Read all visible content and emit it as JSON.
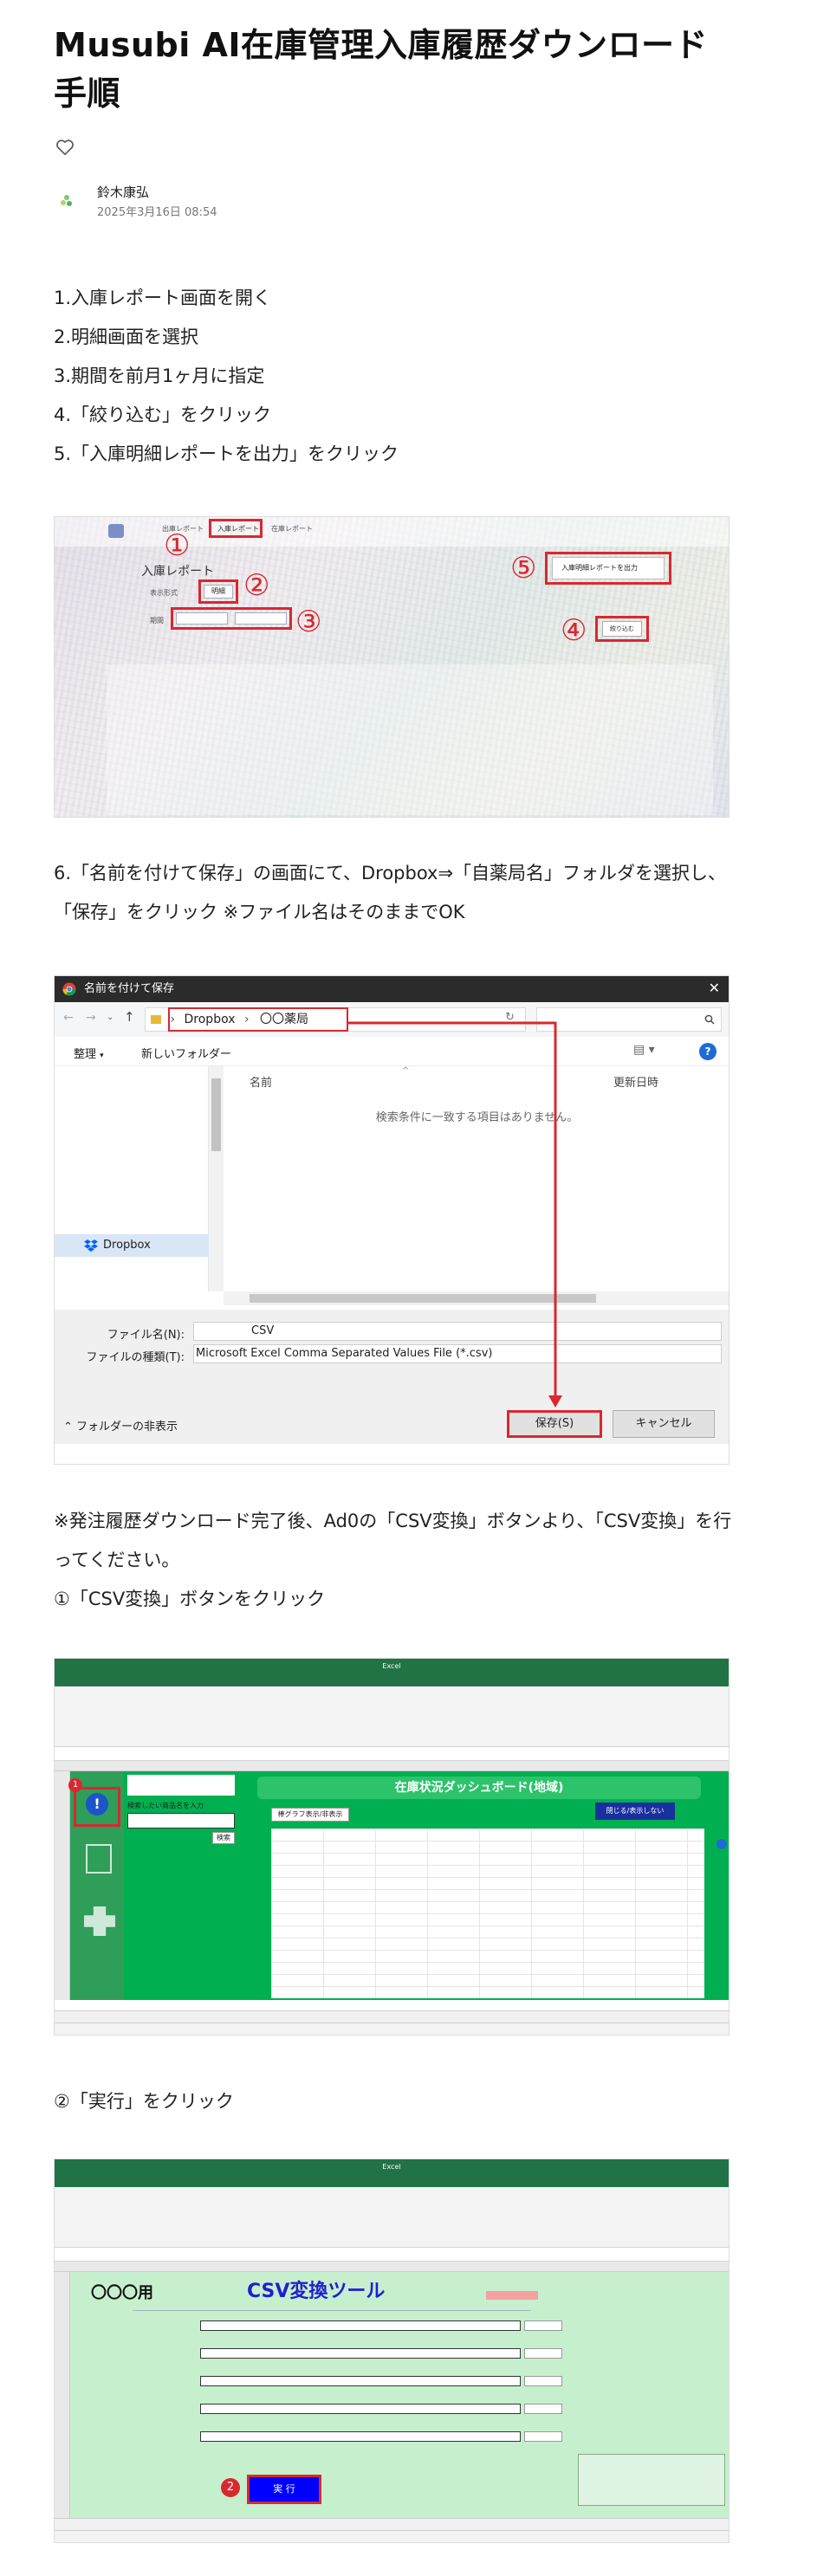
{
  "article": {
    "title": "Musubi AI在庫管理入庫履歴ダウンロード手順",
    "author": "鈴木康弘",
    "date": "2025年3月16日 08:54"
  },
  "steps": [
    "1.入庫レポート画面を開く",
    "2.明細画面を選択",
    "3.期間を前月1ヶ月に指定",
    "4.「絞り込む」をクリック",
    "5.「入庫明細レポートを出力」をクリック"
  ],
  "step6": "6.「名前を付けて保存」の画面にて、Dropbox⇒「自薬局名」フォルダを選択し、「保存」をクリック ※ファイル名はそのままでOK",
  "note": "※発注履歴ダウンロード完了後、Ad0の「CSV変換」ボタンより、「CSV変換」を行ってください。",
  "substep1": "①「CSV変換」ボタンをクリック",
  "substep2": "②「実行」をクリック",
  "shot1": {
    "tabs": [
      "出庫レポート",
      "入庫レポート",
      "在庫レポート"
    ],
    "heading": "入庫レポート",
    "view_label": "表示形式",
    "view_value": "明細",
    "period_label": "期間",
    "output_button": "入庫明細レポートを出力",
    "filter_button": "絞り込む",
    "markers": [
      "①",
      "②",
      "③",
      "④",
      "⑤"
    ],
    "colors": {
      "marker": "#d9282f"
    }
  },
  "shot2": {
    "window_title": "名前を付けて保存",
    "path": [
      "Dropbox",
      "〇〇薬局"
    ],
    "organize": "整理",
    "new_folder": "新しいフォルダー",
    "col_name": "名前",
    "col_date": "更新日時",
    "empty_msg": "検索条件に一致する項目はありません。",
    "nav_dropbox": "Dropbox",
    "filename_label": "ファイル名(N):",
    "filename_value": "CSV",
    "filetype_label": "ファイルの種類(T):",
    "filetype_value": "Microsoft Excel Comma Separated Values File (*.csv)",
    "hide_folders": "フォルダーの非表示",
    "save": "保存(S)",
    "cancel": "キャンセル"
  },
  "shot3": {
    "app_title": "Excel",
    "dashboard_title": "在庫状況ダッシュボード(地域)",
    "graph_button": "棒グラフ表示/非表示",
    "search_label": "検索したい商品名を入力",
    "search_button": "検索",
    "blue_button": "閉じる/表示しない",
    "marker": "1",
    "colors": {
      "excel_green": "#217346",
      "dashboard_green": "#2cc36b",
      "sheet_bg": "#00b050"
    }
  },
  "shot4": {
    "app_title": "Excel",
    "tool_title": "CSV変換ツール",
    "owner": "〇〇〇用",
    "run_button": "実 行",
    "marker": "2",
    "colors": {
      "tool_bg": "#c6efce",
      "title_blue": "#1f1fd0",
      "run_bg": "#0000ff"
    }
  }
}
